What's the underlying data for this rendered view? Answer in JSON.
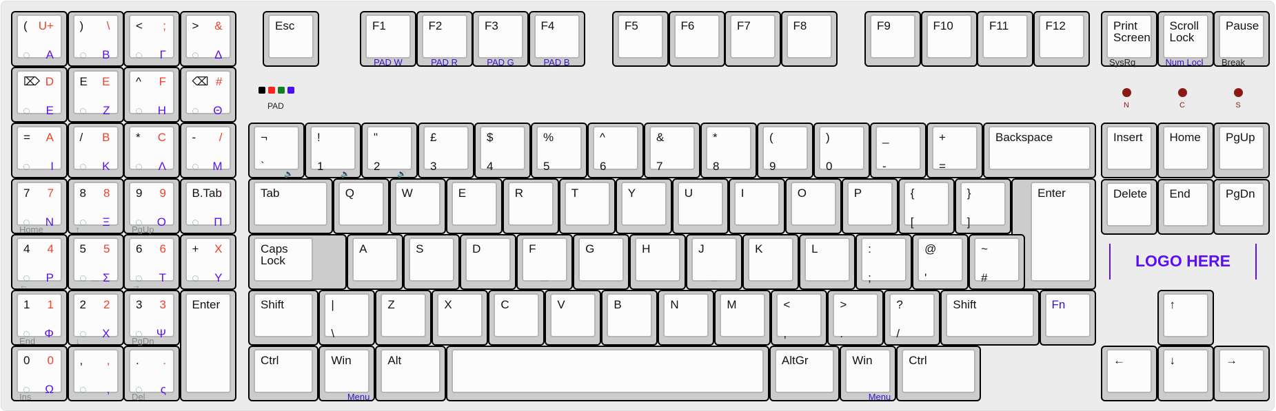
{
  "colors": {
    "background": "#ececec",
    "key_body": "#cccccc",
    "keycap": "#fcfcfc",
    "secondary": "#f0412a",
    "greek": "#5a10f0",
    "front": "#3a10c8",
    "led": "#8b1a14"
  },
  "numpad": [
    {
      "tl": "(",
      "tr": "U+",
      "br": "Α"
    },
    {
      "tl": ")",
      "tr": "\\",
      "br": "Β"
    },
    {
      "tl": "<",
      "tr": ";",
      "br": "Γ"
    },
    {
      "tl": ">",
      "tr": "&",
      "br": "Δ"
    },
    {
      "tl": "⌦",
      "tr": "D",
      "br": "Ε"
    },
    {
      "tl": "E",
      "tr": "E",
      "br": "Ζ"
    },
    {
      "tl": "^",
      "tr": "F",
      "br": "Η"
    },
    {
      "tl": "⌫",
      "tr": "#",
      "br": "Θ"
    },
    {
      "tl": "=",
      "tr": "A",
      "br": "Ι"
    },
    {
      "tl": "/",
      "tr": "B",
      "br": "Κ"
    },
    {
      "tl": "*",
      "tr": "C",
      "br": "Λ"
    },
    {
      "tl": "-",
      "tr": "/",
      "br": "Μ"
    },
    {
      "tl": "7",
      "tr": "7",
      "br": "Ν",
      "front": "Home"
    },
    {
      "tl": "8",
      "tr": "8",
      "br": "Ξ",
      "front": "↑"
    },
    {
      "tl": "9",
      "tr": "9",
      "br": "Ο",
      "front": "PgUp"
    },
    {
      "tl": "B.Tab",
      "tr": ":",
      "br": "Π"
    },
    {
      "tl": "4",
      "tr": "4",
      "br": "Ρ",
      "front": "←"
    },
    {
      "tl": "5",
      "tr": "5",
      "br": "Σ",
      "mid": "_",
      "front": ""
    },
    {
      "tl": "6",
      "tr": "6",
      "br": "Τ",
      "front": "→"
    },
    {
      "tl": "+",
      "tr": "X",
      "br": "Υ"
    },
    {
      "tl": "1",
      "tr": "1",
      "br": "Φ",
      "front": "End"
    },
    {
      "tl": "2",
      "tr": "2",
      "br": "Χ",
      "front": "↓"
    },
    {
      "tl": "3",
      "tr": "3",
      "br": "Ψ",
      "front": "PgDn"
    },
    {
      "tl": "Enter"
    },
    {
      "tl": "0",
      "tr": "0",
      "br": "Ω",
      "front": "Ins"
    },
    {
      "tl": ",",
      "tr": ",",
      "br": ","
    },
    {
      "tl": ".",
      "tr": ".",
      "br": "ς",
      "front": "Del"
    }
  ],
  "function_row": {
    "esc": "Esc",
    "f": [
      {
        "l": "F1",
        "front": "PAD W"
      },
      {
        "l": "F2",
        "front": "PAD R"
      },
      {
        "l": "F3",
        "front": "PAD G"
      },
      {
        "l": "F4",
        "front": "PAD B"
      },
      {
        "l": "F5"
      },
      {
        "l": "F6"
      },
      {
        "l": "F7"
      },
      {
        "l": "F8"
      },
      {
        "l": "F9"
      },
      {
        "l": "F10"
      },
      {
        "l": "F11"
      },
      {
        "l": "F12"
      }
    ],
    "nav": [
      {
        "l": "Print\nScreen",
        "front": "SysRq"
      },
      {
        "l": "Scroll\nLock",
        "front": "Num Lock"
      },
      {
        "l": "Pause",
        "front": "Break"
      }
    ]
  },
  "pad_indicator": {
    "label": "PAD",
    "swatches": [
      "#000000",
      "#ff2020",
      "#108020",
      "#4a10f0"
    ]
  },
  "leds": [
    {
      "label": "N"
    },
    {
      "label": "C"
    },
    {
      "label": "S"
    }
  ],
  "number_row": [
    {
      "t": "¬",
      "b": "`",
      "vol": "🔈"
    },
    {
      "t": "!",
      "b": "1",
      "vol": "🔉"
    },
    {
      "t": "\"",
      "b": "2",
      "vol": "🔊"
    },
    {
      "t": "£",
      "b": "3"
    },
    {
      "t": "$",
      "b": "4"
    },
    {
      "t": "%",
      "b": "5"
    },
    {
      "t": "^",
      "b": "6"
    },
    {
      "t": "&",
      "b": "7"
    },
    {
      "t": "*",
      "b": "8"
    },
    {
      "t": "(",
      "b": "9"
    },
    {
      "t": ")",
      "b": "0"
    },
    {
      "t": "_",
      "b": "-"
    },
    {
      "t": "+",
      "b": "="
    },
    {
      "t": "Backspace"
    }
  ],
  "qwerty_row": [
    {
      "t": "Tab"
    },
    {
      "t": "Q"
    },
    {
      "t": "W"
    },
    {
      "t": "E"
    },
    {
      "t": "R"
    },
    {
      "t": "T"
    },
    {
      "t": "Y"
    },
    {
      "t": "U"
    },
    {
      "t": "I"
    },
    {
      "t": "O"
    },
    {
      "t": "P"
    },
    {
      "t": "{",
      "b": "["
    },
    {
      "t": "}",
      "b": "]"
    },
    {
      "t": "Enter"
    }
  ],
  "home_row": [
    {
      "t": "Caps\nLock"
    },
    {
      "t": "A"
    },
    {
      "t": "S"
    },
    {
      "t": "D"
    },
    {
      "t": "F",
      "m": "_"
    },
    {
      "t": "G"
    },
    {
      "t": "H"
    },
    {
      "t": "J",
      "m": "_"
    },
    {
      "t": "K"
    },
    {
      "t": "L"
    },
    {
      "t": ":",
      "b": ";"
    },
    {
      "t": "@",
      "b": "'"
    },
    {
      "t": "~",
      "b": "#"
    }
  ],
  "shift_row": [
    {
      "t": "Shift"
    },
    {
      "t": "|",
      "b": "\\"
    },
    {
      "t": "Z"
    },
    {
      "t": "X"
    },
    {
      "t": "C"
    },
    {
      "t": "V"
    },
    {
      "t": "B"
    },
    {
      "t": "N"
    },
    {
      "t": "M"
    },
    {
      "t": "<",
      "b": ","
    },
    {
      "t": ">",
      "b": "."
    },
    {
      "t": "?",
      "b": "/"
    },
    {
      "t": "Shift"
    },
    {
      "t": "Fn"
    }
  ],
  "bottom_row": [
    {
      "t": "Ctrl"
    },
    {
      "t": "Win",
      "front": "Menu"
    },
    {
      "t": "Alt"
    },
    {
      "t": ""
    },
    {
      "t": "AltGr"
    },
    {
      "t": "Win",
      "front": "Menu"
    },
    {
      "t": "Ctrl"
    }
  ],
  "nav_cluster": [
    {
      "t": "Insert"
    },
    {
      "t": "Home"
    },
    {
      "t": "PgUp"
    },
    {
      "t": "Delete"
    },
    {
      "t": "End"
    },
    {
      "t": "PgDn"
    }
  ],
  "arrows": [
    {
      "t": "↑"
    },
    {
      "t": "←"
    },
    {
      "t": "↓"
    },
    {
      "t": "→"
    }
  ],
  "logo": "LOGO HERE"
}
